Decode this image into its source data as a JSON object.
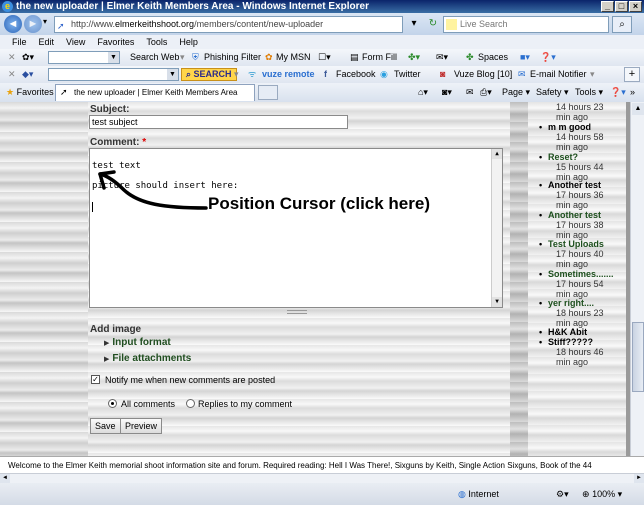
{
  "window": {
    "title": "the new uploader | Elmer Keith Members Area - Windows Internet Explorer"
  },
  "address": {
    "prefix": "http://www.",
    "domain": "elmerkeithshoot.org",
    "path": "/members/content/new-uploader"
  },
  "search": {
    "placeholder": "Live Search"
  },
  "menu": [
    "File",
    "Edit",
    "View",
    "Favorites",
    "Tools",
    "Help"
  ],
  "toolbar1": {
    "search_web": "Search Web",
    "phishing": "Phishing Filter",
    "mymsn": "My MSN",
    "formfill": "Form Fill",
    "spaces": "Spaces"
  },
  "toolbar2": {
    "search_btn": "SEARCH",
    "vuze_remote": "vuze remote",
    "facebook": "Facebook",
    "twitter": "Twitter",
    "vuze_blog": "Vuze Blog [10]",
    "email_notifier": "E-mail Notifier"
  },
  "favorites": {
    "label": "Favorites",
    "tab_title": "the new uploader | Elmer Keith Members Area",
    "page": "Page",
    "safety": "Safety",
    "tools": "Tools"
  },
  "form": {
    "subject_label": "Subject:",
    "subject_value": "test subject",
    "comment_label": "Comment:",
    "required_mark": "*",
    "comment_line1": "test text",
    "comment_line2": "picture should insert here:",
    "annotation": "Position Cursor (click here)",
    "add_image": "Add image",
    "input_format": "Input format",
    "file_attachments": "File attachments",
    "notify": "Notify me when new comments are posted",
    "radio_all": "All comments",
    "radio_replies": "Replies to my comment",
    "save": "Save",
    "preview": "Preview"
  },
  "recent": [
    {
      "title": "",
      "ago1": "14 hours 23",
      "ago2": "min ago"
    },
    {
      "title": "m m good",
      "ago1": "14 hours 58",
      "ago2": "min ago"
    },
    {
      "title": "Reset?",
      "ago1": "15 hours 44",
      "ago2": "min ago"
    },
    {
      "title": "Another test",
      "ago1": "17 hours 36",
      "ago2": "min ago"
    },
    {
      "title": "Another test",
      "ago1": "17 hours 38",
      "ago2": "min ago"
    },
    {
      "title": "Test Uploads",
      "ago1": "17 hours 40",
      "ago2": "min ago"
    },
    {
      "title": "Sometimes.......",
      "ago1": "17 hours 54",
      "ago2": "min ago"
    },
    {
      "title": "yer right....",
      "ago1": "18 hours 23",
      "ago2": "min ago"
    },
    {
      "title": "H&K Abit",
      "title2": "Stiff?????",
      "ago1": "18 hours 46",
      "ago2": "min ago"
    }
  ],
  "footer": {
    "text": "Welcome to the Elmer Keith memorial shoot information site and forum. Required reading: Hell I Was There!, Sixguns by Keith, Single Action Sixguns, Book of the 44"
  },
  "status": {
    "zone": "Internet",
    "zoom": "100%"
  },
  "colors": {
    "link_green": "#1d4f1d",
    "required": "#dd0000",
    "ie_blue": "#0a246a"
  }
}
